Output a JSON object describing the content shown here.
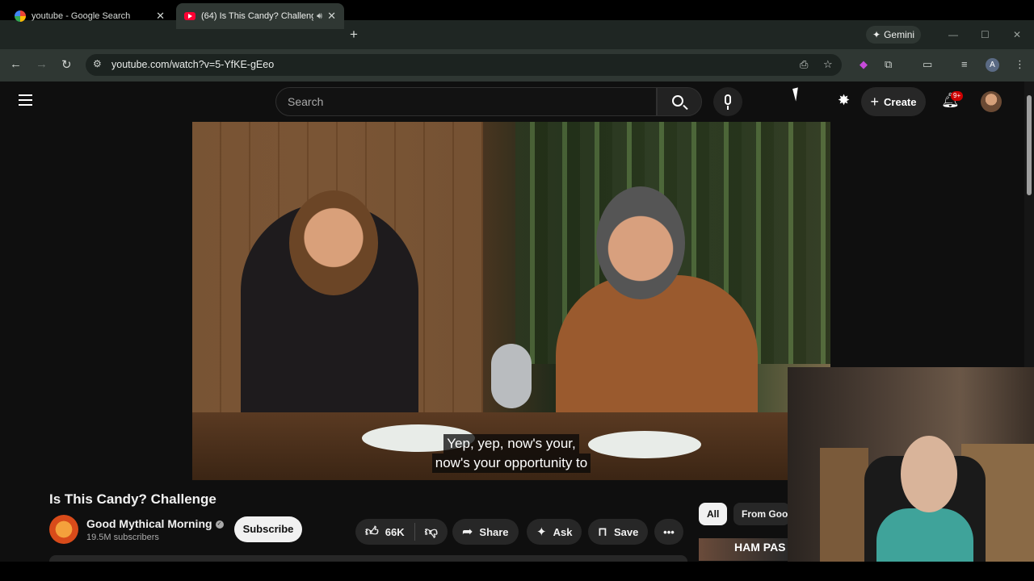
{
  "browser": {
    "tabs": [
      {
        "title": "youtube - Google Search",
        "active": false,
        "favicon": "google-icon"
      },
      {
        "title": "(64) Is This Candy? Challeng",
        "active": true,
        "favicon": "youtube-icon",
        "audio": true
      }
    ],
    "new_tab_glyph": "+",
    "gemini_label": "Gemini",
    "url": "youtube.com/watch?v=5-YfKE-gEeo",
    "profile_initial": "A"
  },
  "youtube": {
    "search_placeholder": "Search",
    "create_label": "Create",
    "notification_count": "9+",
    "video": {
      "caption_line1": "Yep, yep, now's your,",
      "caption_line2": "now's your opportunity to"
    },
    "title": "Is This Candy? Challenge",
    "channel": {
      "name": "Good Mythical Morning",
      "subscribers": "19.5M subscribers"
    },
    "subscribe_label": "Subscribe",
    "actions": {
      "likes": "66K",
      "share": "Share",
      "ask": "Ask",
      "save": "Save"
    },
    "chips": [
      "All",
      "From Good Mythical Morning"
    ],
    "recommended_peek_text": "HAM PAS"
  },
  "colors": {
    "youtube_bg": "#0f0f0f",
    "browser_chrome": "#2f3733",
    "badge_red": "#cc0000"
  }
}
